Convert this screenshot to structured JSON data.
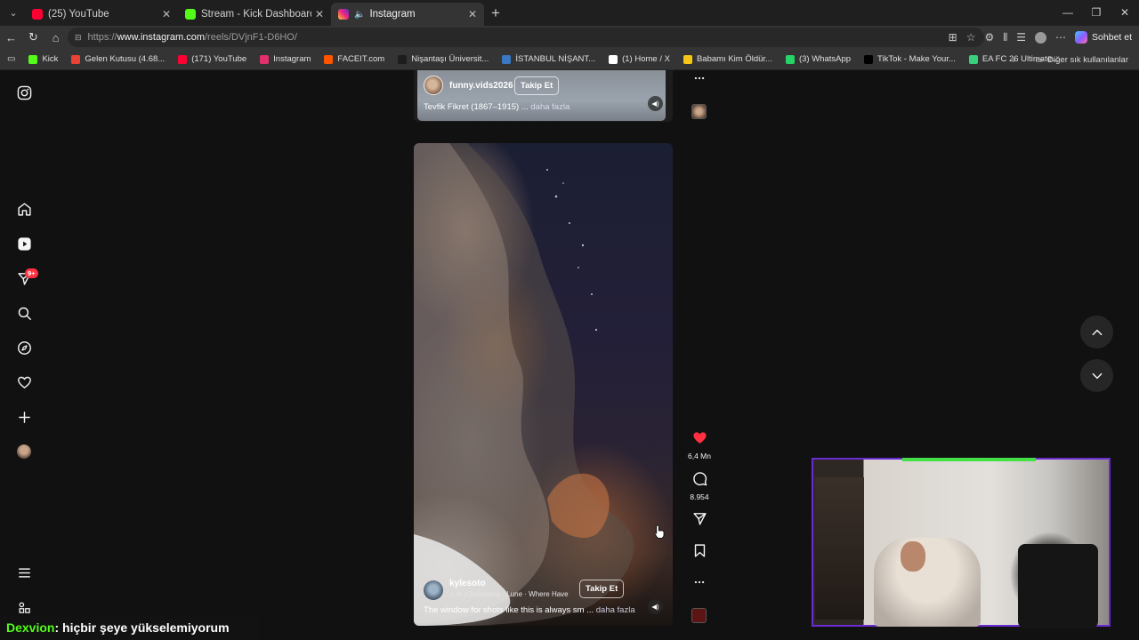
{
  "browser": {
    "tabs": [
      {
        "title": "(25) YouTube",
        "icon": "youtube-icon",
        "color": "#ff0033",
        "active": false
      },
      {
        "title": "Stream - Kick Dashboard",
        "icon": "kick-icon",
        "color": "#53fc18",
        "active": false
      },
      {
        "title": "Instagram",
        "icon": "instagram-icon",
        "color": "#e1306c",
        "active": true
      }
    ],
    "url_prefix": "https://",
    "url_host": "www.instagram.com",
    "url_path": "/reels/DVjnF1-D6HO/",
    "copilot_label": "Sohbet et",
    "bookmarks": [
      {
        "label": "Kick",
        "icon": "kick-icon",
        "color": "#53fc18"
      },
      {
        "label": "Gelen Kutusu (4.68...",
        "icon": "gmail-icon",
        "color": "#ea4335"
      },
      {
        "label": "(171) YouTube",
        "icon": "youtube-icon",
        "color": "#ff0033"
      },
      {
        "label": "Instagram",
        "icon": "instagram-icon",
        "color": "#e1306c"
      },
      {
        "label": "FACEIT.com",
        "icon": "faceit-icon",
        "color": "#ff5500"
      },
      {
        "label": "Nişantaşı Üniversit...",
        "icon": "university-icon",
        "color": "#1d1d1d"
      },
      {
        "label": "İSTANBUL NİŞANT...",
        "icon": "page-icon",
        "color": "#3a78c4"
      },
      {
        "label": "(1) Home / X",
        "icon": "x-icon",
        "color": "#ffffff"
      },
      {
        "label": "Babamı Kim Öldür...",
        "icon": "imdb-icon",
        "color": "#f5c518"
      },
      {
        "label": "(3) WhatsApp",
        "icon": "whatsapp-icon",
        "color": "#25d366"
      },
      {
        "label": "TikTok - Make Your...",
        "icon": "tiktok-icon",
        "color": "#000000"
      },
      {
        "label": "EA FC 26 Ultimate...",
        "icon": "ea-icon",
        "color": "#38d07a"
      }
    ],
    "other_bookmarks": "Diğer sık kullanılanlar"
  },
  "sidebar": {
    "notification_badge": "9+"
  },
  "reel_top": {
    "username": "funny.vids2026",
    "follow_label": "Takip Et",
    "caption": "Tevfik Fikret (1867–1915) ...",
    "more": "daha fazla"
  },
  "reel_main": {
    "username": "kylesoto",
    "music": "Orchestra) · Lune · Where Have",
    "music_prefix": "in (",
    "follow_label": "Takip Et",
    "caption": "The window for shots like this is always sm ...",
    "more": "daha fazla",
    "likes": "6,4 Mn",
    "comments": "8.954"
  },
  "stream_chat": {
    "username": "Dexvion",
    "message": ": hiçbir şeye yükselemiyorum"
  }
}
